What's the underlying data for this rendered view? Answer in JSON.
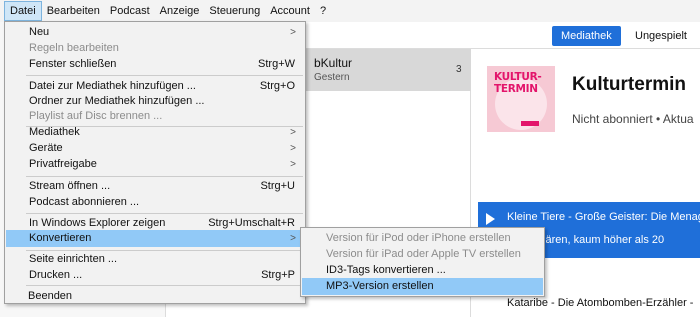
{
  "menubar": {
    "items": [
      {
        "label": "Datei",
        "active": true
      },
      {
        "label": "Bearbeiten"
      },
      {
        "label": "Podcast"
      },
      {
        "label": "Anzeige"
      },
      {
        "label": "Steuerung"
      },
      {
        "label": "Account"
      },
      {
        "label": "?"
      }
    ]
  },
  "header": {
    "tab_library": "Mediathek",
    "tab_unplayed": "Ungespielt",
    "accent": "#1f6fd9"
  },
  "list": {
    "item_name": "bKultur",
    "item_sub": "Gestern",
    "item_count": "3"
  },
  "detail": {
    "art_line1": "KULTUR-",
    "art_line2": "TERMIN",
    "title": "Kulturtermin",
    "meta": "Nicht abonniert • Aktua",
    "episode_line1": "Kleine Tiere - Große Geister: Die Menag",
    "episode_line2": "ferde, Bären, kaum höher als 20",
    "next_episode": "Kataribe - Die Atombomben-Erzähler -"
  },
  "file_menu": {
    "items": [
      {
        "label": "Neu",
        "submenu": true
      },
      {
        "label": "Regeln bearbeiten",
        "disabled": true
      },
      {
        "label": "Fenster schließen",
        "shortcut": "Strg+W"
      },
      {
        "label": "Datei zur Mediathek hinzufügen ...",
        "shortcut": "Strg+O"
      },
      {
        "label": "Ordner zur Mediathek hinzufügen ..."
      },
      {
        "label": "Playlist auf Disc brennen ...",
        "disabled": true
      },
      {
        "label": "Mediathek",
        "submenu": true
      },
      {
        "label": "Geräte",
        "submenu": true
      },
      {
        "label": "Privatfreigabe",
        "submenu": true
      },
      {
        "label": "Stream öffnen ...",
        "shortcut": "Strg+U"
      },
      {
        "label": "Podcast abonnieren ..."
      },
      {
        "label": "In Windows Explorer zeigen",
        "shortcut": "Strg+Umschalt+R"
      },
      {
        "label": "Konvertieren",
        "submenu": true,
        "highlighted": true
      },
      {
        "label": "Seite einrichten ..."
      },
      {
        "label": "Drucken ...",
        "shortcut": "Strg+P"
      },
      {
        "label": "Beenden"
      }
    ]
  },
  "convert_submenu": {
    "items": [
      {
        "label": "Version für iPod oder iPhone erstellen",
        "disabled": true
      },
      {
        "label": "Version für iPad oder Apple TV erstellen",
        "disabled": true
      },
      {
        "label": "ID3-Tags konvertieren ..."
      },
      {
        "label": "MP3-Version erstellen",
        "highlighted": true
      }
    ]
  },
  "colors": {
    "menu_highlight": "#91c9f7",
    "disabled_text": "#8c8c8c",
    "art_pink": "#e3156b"
  }
}
